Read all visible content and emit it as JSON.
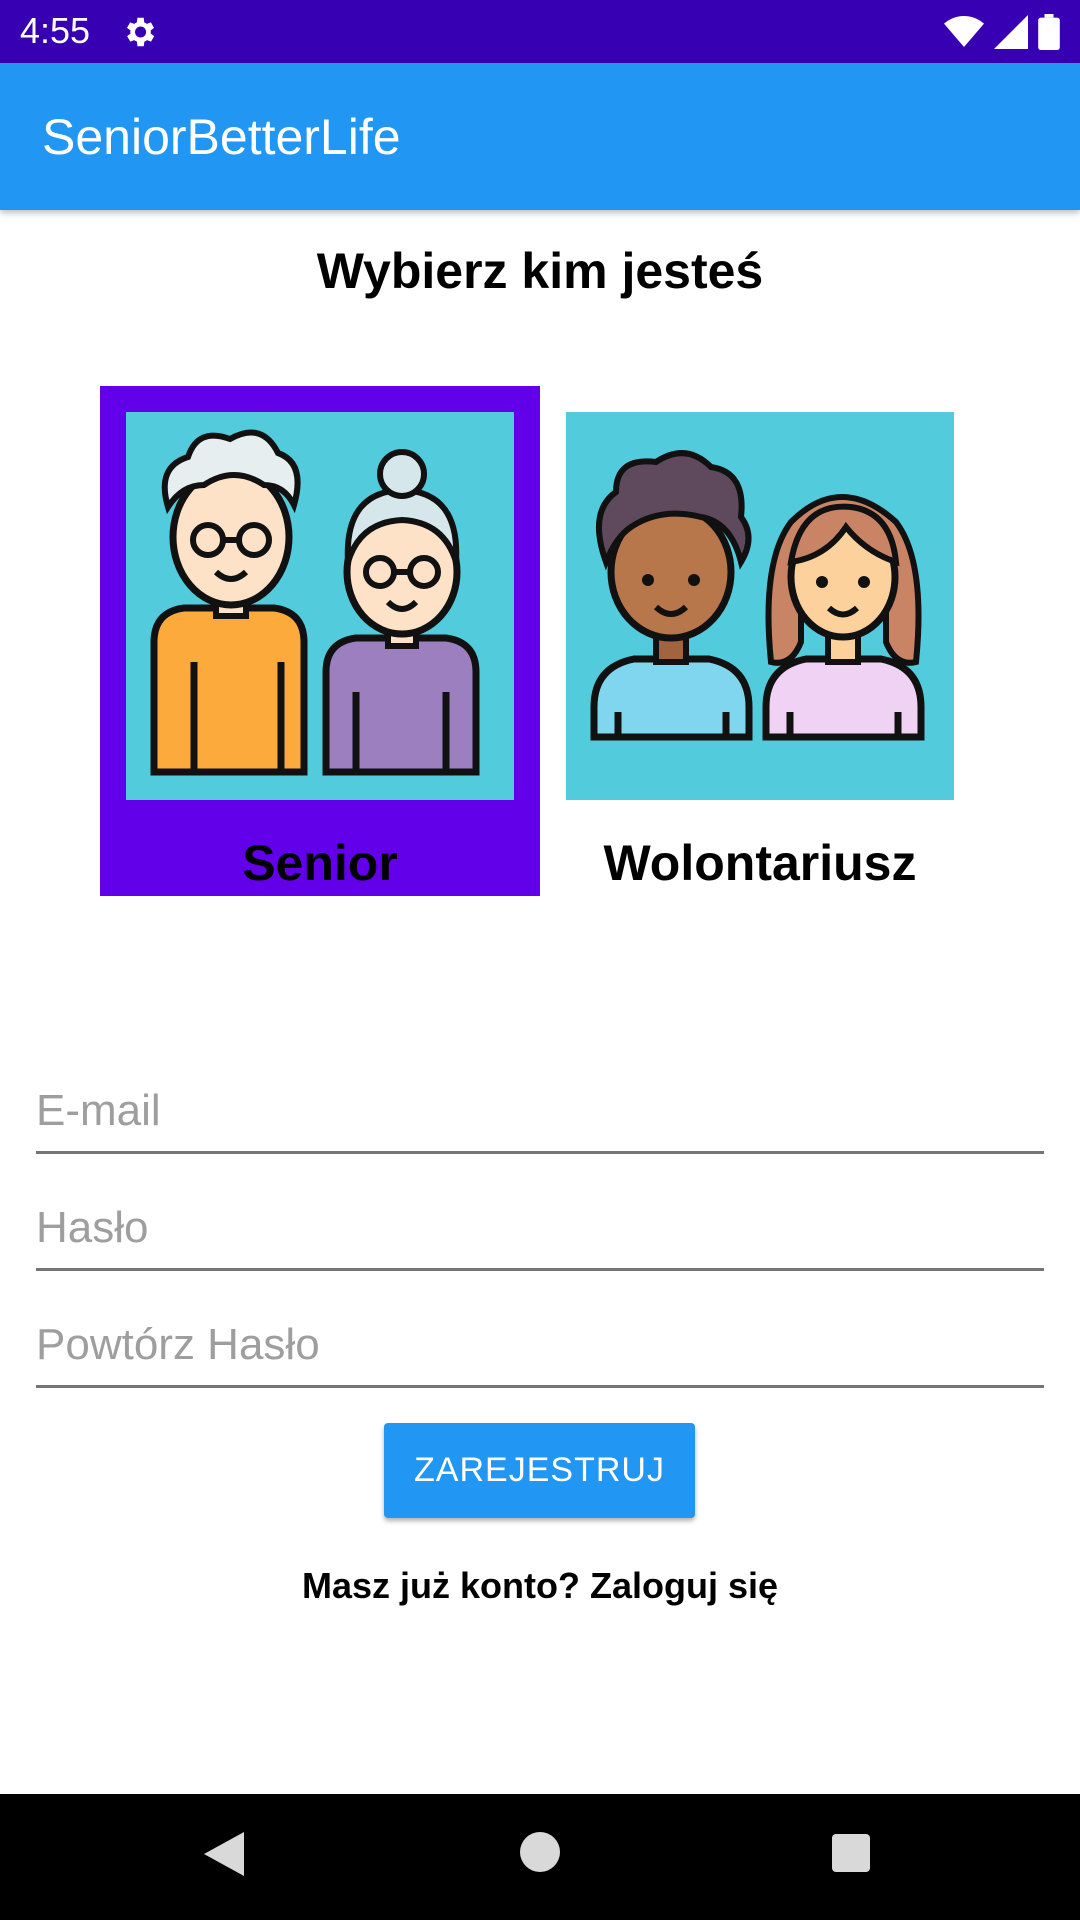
{
  "status_bar": {
    "time": "4:55"
  },
  "app_bar": {
    "title": "SeniorBetterLife"
  },
  "page": {
    "heading": "Wybierz kim jesteś",
    "roles": [
      {
        "label": "Senior",
        "selected": true
      },
      {
        "label": "Wolontariusz",
        "selected": false
      }
    ]
  },
  "form": {
    "email_placeholder": "E-mail",
    "password_placeholder": "Hasło",
    "repeat_password_placeholder": "Powtórz Hasło",
    "register_label": "ZAREJESTRUJ",
    "login_prompt": "Masz już konto? Zaloguj się"
  },
  "colors": {
    "status_bar": "#3700b3",
    "app_bar": "#2196f3",
    "selected_role": "#6200ea",
    "image_bg": "#52cbdc"
  }
}
